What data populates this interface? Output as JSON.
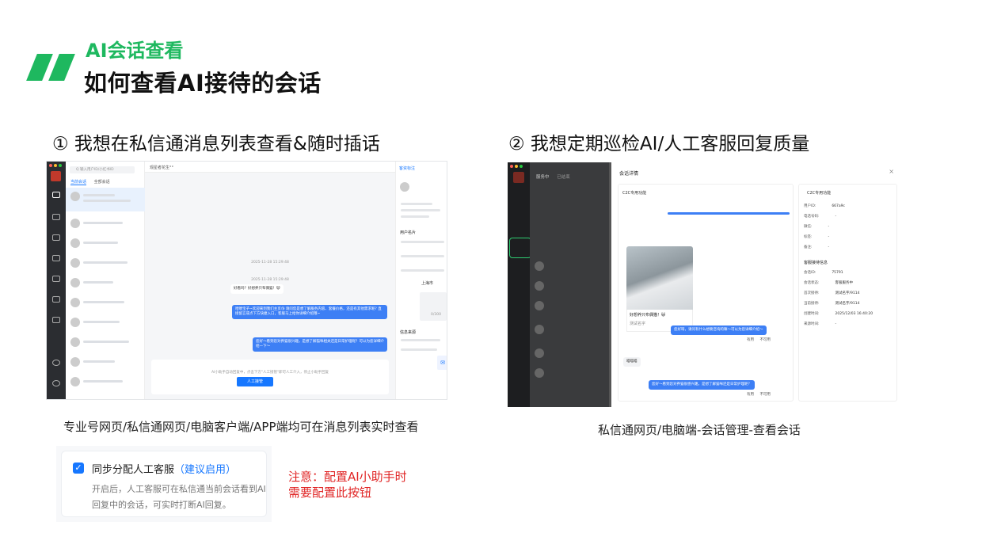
{
  "header": {
    "kicker": "AI会话查看",
    "title": "如何查看AI接待的会话"
  },
  "colors": {
    "accent": "#1eb85f",
    "primary_blue": "#1677ff",
    "warning_red": "#e02424"
  },
  "section1": {
    "title": "① 我想在私信通消息列表查看&随时插话",
    "caption": "专业号网页/私信通网页/电脑客户端/APP端均可在消息列表实时查看",
    "screenshot": {
      "search_placeholder": "Q 输入用户ID/小红书ID",
      "tabs": [
        "当前会话",
        "全部会话"
      ],
      "chat_header": "观星者花生°°",
      "side_tab": "客资标注",
      "takeover_button": "人工接管",
      "ai_notice": "AI小助手自动回复中，点击下方\"人工接管\"即可人工介入，停止小助手回复",
      "time1": "2025-11-28 15:29:48",
      "time2": "2025-11-28 15:29:48",
      "bubble_user": "好看吗？好想养只布偶猫！😺",
      "bubble_ai1": "哈喽宝子~欢迎来到我们主页😘 请问您是想了解服务内容、套餐价格，还是有其他需求呢? 直接留言或点下方快捷入口，客服马上给你详细介绍哦~",
      "bubble_ai2": "您好～看到您对养猫很兴趣，是想了解猫咪相关还是日常护理呢？可以为您详细介绍一下～",
      "card_title": "用户名片",
      "source_title": "信息来源",
      "city": "上海市",
      "counter": "0/300",
      "verify_icon": "mail-icon"
    }
  },
  "section2": {
    "title": "② 我想定期巡检AI/人工客服回复质量",
    "caption": "私信通网页/电脑端-会话管理-查看会话",
    "screenshot": {
      "modal_title": "会话详情",
      "chat_title": "C2C专用功能",
      "info_title": "C2C专用功能",
      "photo_caption": "好想养只布偶猫！😺",
      "photo_sub": "测试名字",
      "bubble1": "您好呀，请问有什么想要咨询的嘛～可以为您详细介绍～",
      "bubble2": "您好～看到您对养猫很感兴趣，是想了解猫咪还是日常护理呢？",
      "reply_text": "喵喵喵",
      "list_tabs": [
        "服务中",
        "已结束"
      ],
      "useful": "有用",
      "useless": "不可用",
      "fields": [
        {
          "k": "用户ID:",
          "v": "667a9c"
        },
        {
          "k": "电话号码:",
          "v": "-"
        },
        {
          "k": "微信:",
          "v": "-"
        },
        {
          "k": "标签:",
          "v": "-"
        },
        {
          "k": "备注:",
          "v": "-"
        }
      ],
      "service_title": "客服接待信息",
      "service_fields": [
        {
          "k": "会话ID:",
          "v": "75791"
        },
        {
          "k": "会话状态:",
          "v": "客服服务中"
        },
        {
          "k": "首次接待:",
          "v": "测试名字/9114"
        },
        {
          "k": "当前接待:",
          "v": "测试名字/9114"
        },
        {
          "k": "创建时间:",
          "v": "2025/12/03 16:40:20"
        },
        {
          "k": "来源时间:",
          "v": "-"
        }
      ]
    }
  },
  "option": {
    "label": "同步分配人工客服",
    "hint": "（建议启用）",
    "description": "开启后，人工客服可在私信通当前会话看到AI回复中的会话，可实时打断AI回复。",
    "checked": true
  },
  "note": {
    "line1": "注意：配置AI小助手时",
    "line2": "需要配置此按钮"
  }
}
